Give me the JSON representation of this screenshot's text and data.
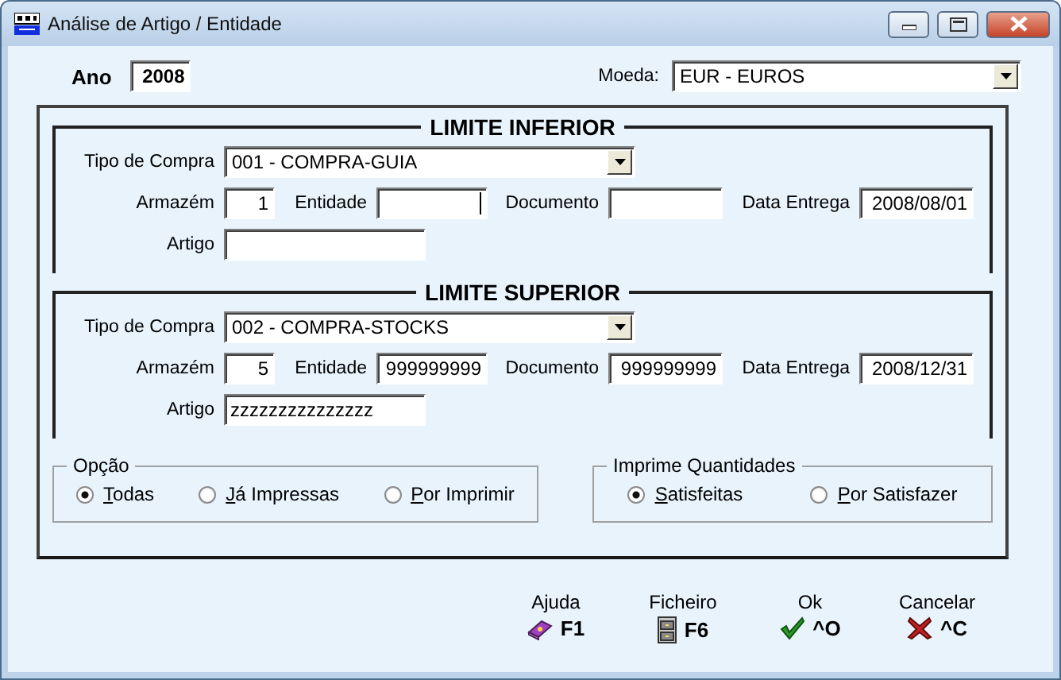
{
  "window": {
    "title": "Análise de Artigo / Entidade"
  },
  "ano": {
    "label": "Ano",
    "value": "2008"
  },
  "moeda": {
    "label": "Moeda:",
    "value": "EUR - EUROS"
  },
  "limits": [
    {
      "title": "LIMITE INFERIOR",
      "tipo_compra": {
        "label": "Tipo de Compra",
        "value": "001 - COMPRA-GUIA"
      },
      "armazem": {
        "label": "Armazém",
        "value": "1"
      },
      "entidade": {
        "label": "Entidade",
        "focused": true
      },
      "documento": {
        "label": "Documento"
      },
      "data_entrega": {
        "label": "Data Entrega",
        "value": "2008/08/01"
      },
      "artigo": {
        "label": "Artigo"
      }
    },
    {
      "title": "LIMITE SUPERIOR",
      "tipo_compra": {
        "label": "Tipo de Compra",
        "value": "002 - COMPRA-STOCKS"
      },
      "armazem": {
        "label": "Armazém",
        "value": "5"
      },
      "entidade": {
        "label": "Entidade",
        "value": "999999999",
        "focused": false
      },
      "documento": {
        "label": "Documento",
        "value": "999999999"
      },
      "data_entrega": {
        "label": "Data Entrega",
        "value": "2008/12/31"
      },
      "artigo": {
        "label": "Artigo",
        "value": "zzzzzzzzzzzzzzz"
      }
    }
  ],
  "opcao": {
    "title": "Opção",
    "options": [
      {
        "label": "Todas",
        "selected": true
      },
      {
        "label": "Já Impressas",
        "selected": false
      },
      {
        "label": "Por Imprimir",
        "selected": false
      }
    ]
  },
  "imprime": {
    "title": "Imprime Quantidades",
    "options": [
      {
        "label": "Satisfeitas",
        "selected": true
      },
      {
        "label": "Por Satisfazer",
        "selected": false
      }
    ]
  },
  "buttons": [
    {
      "label": "Ajuda",
      "key": "F1",
      "kind": "help"
    },
    {
      "label": "Ficheiro",
      "key": "F6",
      "kind": "file"
    },
    {
      "label": "Ok",
      "key": "^O",
      "kind": "ok"
    },
    {
      "label": "Cancelar",
      "key": "^C",
      "kind": "cancel"
    }
  ]
}
